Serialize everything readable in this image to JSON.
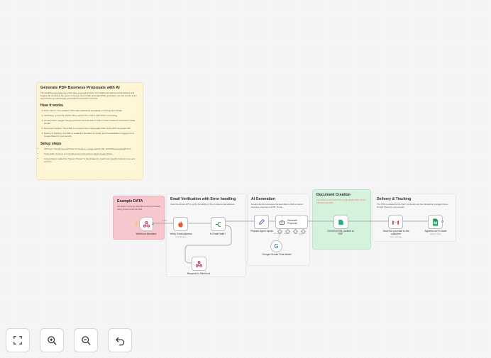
{
  "notes": {
    "main": {
      "title": "Generate PDF Business Proposals with AI",
      "intro": "This workflow automates the entire sales proposal process, from initial lead capture to final delivery and logging. By combining the power of Google Gemini with automated PDF generation, you can ensure every lead receives a professional, personalized proposal in seconds.",
      "how_title": "How it works",
      "how_items": [
        "Data Capture: The workflow starts with a Webhook (simulated) containing lead details.",
        "Verification: It uses the Hunter API to ensure the email is valid before proceeding.",
        "AI Generation: Google Gemini processes the lead data to draft a custom business proposal in HTML format.",
        "Document Creation: The HTML is converted into a high-quality PDF via the PDF Generator API.",
        "Delivery & Tracking: The PDF is emailed to the client via Gmail, and the transaction is logged into a Google Sheet for your records."
      ],
      "setup_title": "Setup steps",
      "setup_items": [
        "API Keys: You will need API keys for Hunter.io, Google Gemini (AI), and PDFGeneratorAPI.com.",
        "Credentials: Connect your Gmail account and select a target Google Sheet.",
        "Customization: Adjust the \"System Prompt\" in the AI Agent to match your specific business tone and services."
      ]
    },
    "example": {
      "title": "Example DATA",
      "desc": "Simulates incoming data (like a new Form lead) using pinned webhook data.",
      "color": "#f8c6cd"
    },
    "email": {
      "title": "Email Verification with Error handling",
      "desc": "Uses the Hunter API to verify the validity of the provided email address."
    },
    "ai": {
      "title": "AI Generation",
      "desc": "Google Gemini processes the lead data to draft a custom business proposal in HTML format."
    },
    "doc": {
      "title": "Document Creation",
      "desc": "The HTML is converted into a high-quality PDF via the PDFGeneratorAPI",
      "color": "#d4f2dc"
    },
    "delivery": {
      "title": "Delivery & Tracking",
      "desc": "The PDF is emailed to the client via Gmail, and the transaction is logged into a Google Sheet for your records."
    }
  },
  "nodes": {
    "webhook": {
      "label": "Webhook simulator"
    },
    "verify": {
      "label": "Verify Email Address",
      "sub": "processEmail"
    },
    "is_valid": {
      "label": "Is Email Valid?"
    },
    "respond": {
      "label": "Respond to Webhook"
    },
    "prepare": {
      "label": "Prepare Agent Inputs"
    },
    "agent": {
      "label": "Generate Proposal",
      "ports": [
        "Chat Model",
        "Memory",
        "Tool",
        "Output Parser"
      ]
    },
    "gemini": {
      "label": "Google Gemini Chat Model"
    },
    "convert": {
      "label": "Convert HTML content to PDF"
    },
    "send": {
      "label": "Send the proposal to the customer",
      "sub": "send: message"
    },
    "append": {
      "label": "Append row in sheet",
      "sub": "append: sheet"
    }
  },
  "controls": {
    "fit": "fit-view",
    "zoom_in": "zoom-in",
    "zoom_out": "zoom-out",
    "undo": "undo"
  },
  "colors": {
    "accent": "#ff6d5a",
    "yellow_note": "#fff6d6",
    "pink_note": "#f8c6cd",
    "green_note": "#d4f2dc",
    "hunter": "#f4511e",
    "gmail": "#ea4335",
    "sheets": "#0f9d58",
    "pdf": "#1db681"
  }
}
